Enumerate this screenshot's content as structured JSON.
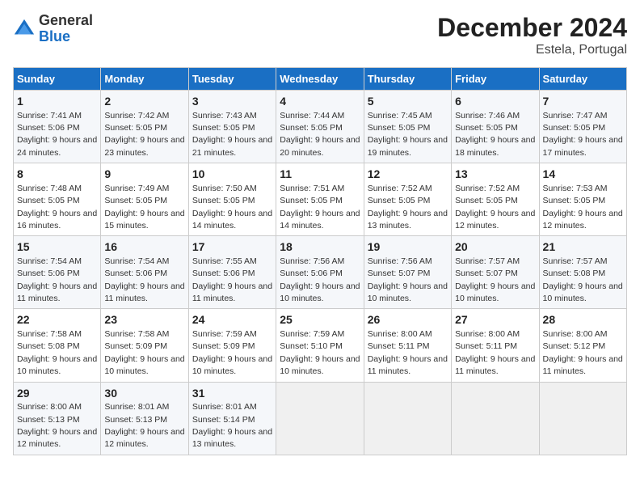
{
  "logo": {
    "general": "General",
    "blue": "Blue"
  },
  "title": "December 2024",
  "subtitle": "Estela, Portugal",
  "weekdays": [
    "Sunday",
    "Monday",
    "Tuesday",
    "Wednesday",
    "Thursday",
    "Friday",
    "Saturday"
  ],
  "weeks": [
    [
      {
        "day": "1",
        "sunrise": "7:41 AM",
        "sunset": "5:06 PM",
        "daylight": "9 hours and 24 minutes."
      },
      {
        "day": "2",
        "sunrise": "7:42 AM",
        "sunset": "5:05 PM",
        "daylight": "9 hours and 23 minutes."
      },
      {
        "day": "3",
        "sunrise": "7:43 AM",
        "sunset": "5:05 PM",
        "daylight": "9 hours and 21 minutes."
      },
      {
        "day": "4",
        "sunrise": "7:44 AM",
        "sunset": "5:05 PM",
        "daylight": "9 hours and 20 minutes."
      },
      {
        "day": "5",
        "sunrise": "7:45 AM",
        "sunset": "5:05 PM",
        "daylight": "9 hours and 19 minutes."
      },
      {
        "day": "6",
        "sunrise": "7:46 AM",
        "sunset": "5:05 PM",
        "daylight": "9 hours and 18 minutes."
      },
      {
        "day": "7",
        "sunrise": "7:47 AM",
        "sunset": "5:05 PM",
        "daylight": "9 hours and 17 minutes."
      }
    ],
    [
      {
        "day": "8",
        "sunrise": "7:48 AM",
        "sunset": "5:05 PM",
        "daylight": "9 hours and 16 minutes."
      },
      {
        "day": "9",
        "sunrise": "7:49 AM",
        "sunset": "5:05 PM",
        "daylight": "9 hours and 15 minutes."
      },
      {
        "day": "10",
        "sunrise": "7:50 AM",
        "sunset": "5:05 PM",
        "daylight": "9 hours and 14 minutes."
      },
      {
        "day": "11",
        "sunrise": "7:51 AM",
        "sunset": "5:05 PM",
        "daylight": "9 hours and 14 minutes."
      },
      {
        "day": "12",
        "sunrise": "7:52 AM",
        "sunset": "5:05 PM",
        "daylight": "9 hours and 13 minutes."
      },
      {
        "day": "13",
        "sunrise": "7:52 AM",
        "sunset": "5:05 PM",
        "daylight": "9 hours and 12 minutes."
      },
      {
        "day": "14",
        "sunrise": "7:53 AM",
        "sunset": "5:05 PM",
        "daylight": "9 hours and 12 minutes."
      }
    ],
    [
      {
        "day": "15",
        "sunrise": "7:54 AM",
        "sunset": "5:06 PM",
        "daylight": "9 hours and 11 minutes."
      },
      {
        "day": "16",
        "sunrise": "7:54 AM",
        "sunset": "5:06 PM",
        "daylight": "9 hours and 11 minutes."
      },
      {
        "day": "17",
        "sunrise": "7:55 AM",
        "sunset": "5:06 PM",
        "daylight": "9 hours and 11 minutes."
      },
      {
        "day": "18",
        "sunrise": "7:56 AM",
        "sunset": "5:06 PM",
        "daylight": "9 hours and 10 minutes."
      },
      {
        "day": "19",
        "sunrise": "7:56 AM",
        "sunset": "5:07 PM",
        "daylight": "9 hours and 10 minutes."
      },
      {
        "day": "20",
        "sunrise": "7:57 AM",
        "sunset": "5:07 PM",
        "daylight": "9 hours and 10 minutes."
      },
      {
        "day": "21",
        "sunrise": "7:57 AM",
        "sunset": "5:08 PM",
        "daylight": "9 hours and 10 minutes."
      }
    ],
    [
      {
        "day": "22",
        "sunrise": "7:58 AM",
        "sunset": "5:08 PM",
        "daylight": "9 hours and 10 minutes."
      },
      {
        "day": "23",
        "sunrise": "7:58 AM",
        "sunset": "5:09 PM",
        "daylight": "9 hours and 10 minutes."
      },
      {
        "day": "24",
        "sunrise": "7:59 AM",
        "sunset": "5:09 PM",
        "daylight": "9 hours and 10 minutes."
      },
      {
        "day": "25",
        "sunrise": "7:59 AM",
        "sunset": "5:10 PM",
        "daylight": "9 hours and 10 minutes."
      },
      {
        "day": "26",
        "sunrise": "8:00 AM",
        "sunset": "5:11 PM",
        "daylight": "9 hours and 11 minutes."
      },
      {
        "day": "27",
        "sunrise": "8:00 AM",
        "sunset": "5:11 PM",
        "daylight": "9 hours and 11 minutes."
      },
      {
        "day": "28",
        "sunrise": "8:00 AM",
        "sunset": "5:12 PM",
        "daylight": "9 hours and 11 minutes."
      }
    ],
    [
      {
        "day": "29",
        "sunrise": "8:00 AM",
        "sunset": "5:13 PM",
        "daylight": "9 hours and 12 minutes."
      },
      {
        "day": "30",
        "sunrise": "8:01 AM",
        "sunset": "5:13 PM",
        "daylight": "9 hours and 12 minutes."
      },
      {
        "day": "31",
        "sunrise": "8:01 AM",
        "sunset": "5:14 PM",
        "daylight": "9 hours and 13 minutes."
      },
      null,
      null,
      null,
      null
    ]
  ]
}
